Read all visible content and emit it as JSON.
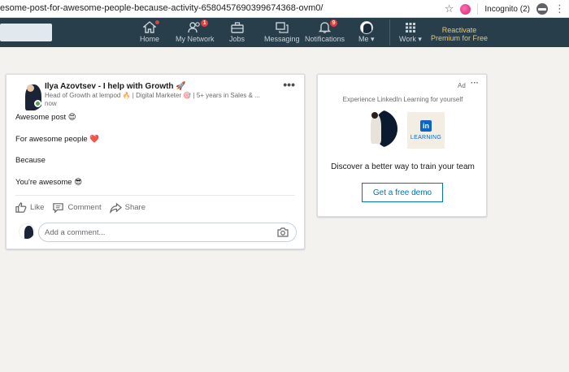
{
  "browser": {
    "url_prefix": "esome-post-for-awesome-people-because-activity-6580457690399674368-ovm0/",
    "incognito_label": "Incognito (2)"
  },
  "nav": {
    "items": [
      {
        "label": "Home",
        "icon": "home-icon",
        "badge": ""
      },
      {
        "label": "My Network",
        "icon": "network-icon",
        "badge": "1"
      },
      {
        "label": "Jobs",
        "icon": "briefcase-icon",
        "badge": ""
      },
      {
        "label": "Messaging",
        "icon": "messaging-icon",
        "badge": ""
      },
      {
        "label": "Notifications",
        "icon": "bell-icon",
        "badge": "9"
      },
      {
        "label": "Me ▾",
        "icon": "avatar",
        "badge": ""
      },
      {
        "label": "Work ▾",
        "icon": "grid-icon",
        "badge": ""
      }
    ],
    "premium_line1": "Reactivate",
    "premium_line2": "Premium for Free"
  },
  "post": {
    "author_name": "Ilya Azovtsev - I help with Growth 🚀",
    "author_headline": "Head of Growth at lempod 🔥 | Digital Marketer 🎯 | 5+ years in Sales & ...",
    "time": "now",
    "lines": [
      "Awesome post 😍",
      "For awesome people ❤️",
      "Because",
      "You're awesome 😎"
    ],
    "actions": {
      "like": "Like",
      "comment": "Comment",
      "share": "Share"
    },
    "comment_placeholder": "Add a comment..."
  },
  "ad": {
    "label": "Ad",
    "tagline": "Experience LinkedIn Learning for yourself",
    "logo_text": "LEARNING",
    "logo_mark": "in",
    "headline": "Discover a better way to train your team",
    "cta": "Get a free demo"
  },
  "colors": {
    "nav_bg": "#283e4a",
    "accent_blue": "#0073b1",
    "badge_red": "#e03e3e",
    "premium_gold": "#e7c877"
  }
}
